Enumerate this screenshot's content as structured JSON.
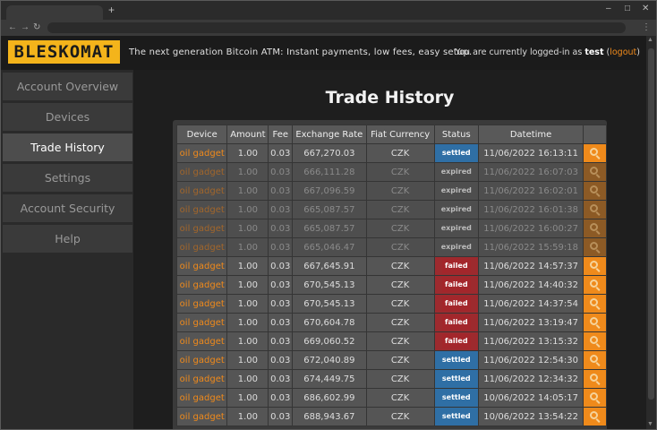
{
  "header": {
    "logo": "BLESKOMAT",
    "tagline": "The next generation Bitcoin ATM: Instant payments, low fees, easy setup.",
    "login_prefix": "You are currently logged-in as",
    "username": "test",
    "logout_label": "logout"
  },
  "sidebar": {
    "items": [
      {
        "label": "Account Overview"
      },
      {
        "label": "Devices"
      },
      {
        "label": "Trade History"
      },
      {
        "label": "Settings"
      },
      {
        "label": "Account Security"
      },
      {
        "label": "Help"
      }
    ]
  },
  "main": {
    "title": "Trade History",
    "columns": [
      "Device",
      "Amount",
      "Fee",
      "Exchange Rate",
      "Fiat Currency",
      "Status",
      "Datetime"
    ],
    "rows": [
      {
        "device": "oil gadget",
        "amount": "1.00",
        "fee": "0.03",
        "rate": "667,270.03",
        "fiat": "CZK",
        "status": "settled",
        "datetime": "11/06/2022 16:13:11"
      },
      {
        "device": "oil gadget",
        "amount": "1.00",
        "fee": "0.03",
        "rate": "666,111.28",
        "fiat": "CZK",
        "status": "expired",
        "datetime": "11/06/2022 16:07:03"
      },
      {
        "device": "oil gadget",
        "amount": "1.00",
        "fee": "0.03",
        "rate": "667,096.59",
        "fiat": "CZK",
        "status": "expired",
        "datetime": "11/06/2022 16:02:01"
      },
      {
        "device": "oil gadget",
        "amount": "1.00",
        "fee": "0.03",
        "rate": "665,087.57",
        "fiat": "CZK",
        "status": "expired",
        "datetime": "11/06/2022 16:01:38"
      },
      {
        "device": "oil gadget",
        "amount": "1.00",
        "fee": "0.03",
        "rate": "665,087.57",
        "fiat": "CZK",
        "status": "expired",
        "datetime": "11/06/2022 16:00:27"
      },
      {
        "device": "oil gadget",
        "amount": "1.00",
        "fee": "0.03",
        "rate": "665,046.47",
        "fiat": "CZK",
        "status": "expired",
        "datetime": "11/06/2022 15:59:18"
      },
      {
        "device": "oil gadget",
        "amount": "1.00",
        "fee": "0.03",
        "rate": "667,645.91",
        "fiat": "CZK",
        "status": "failed",
        "datetime": "11/06/2022 14:57:37"
      },
      {
        "device": "oil gadget",
        "amount": "1.00",
        "fee": "0.03",
        "rate": "670,545.13",
        "fiat": "CZK",
        "status": "failed",
        "datetime": "11/06/2022 14:40:32"
      },
      {
        "device": "oil gadget",
        "amount": "1.00",
        "fee": "0.03",
        "rate": "670,545.13",
        "fiat": "CZK",
        "status": "failed",
        "datetime": "11/06/2022 14:37:54"
      },
      {
        "device": "oil gadget",
        "amount": "1.00",
        "fee": "0.03",
        "rate": "670,604.78",
        "fiat": "CZK",
        "status": "failed",
        "datetime": "11/06/2022 13:19:47"
      },
      {
        "device": "oil gadget",
        "amount": "1.00",
        "fee": "0.03",
        "rate": "669,060.52",
        "fiat": "CZK",
        "status": "failed",
        "datetime": "11/06/2022 13:15:32"
      },
      {
        "device": "oil gadget",
        "amount": "1.00",
        "fee": "0.03",
        "rate": "672,040.89",
        "fiat": "CZK",
        "status": "settled",
        "datetime": "11/06/2022 12:54:30"
      },
      {
        "device": "oil gadget",
        "amount": "1.00",
        "fee": "0.03",
        "rate": "674,449.75",
        "fiat": "CZK",
        "status": "settled",
        "datetime": "11/06/2022 12:34:32"
      },
      {
        "device": "oil gadget",
        "amount": "1.00",
        "fee": "0.03",
        "rate": "686,602.99",
        "fiat": "CZK",
        "status": "settled",
        "datetime": "10/06/2022 14:05:17"
      },
      {
        "device": "oil gadget",
        "amount": "1.00",
        "fee": "0.03",
        "rate": "688,943.67",
        "fiat": "CZK",
        "status": "settled",
        "datetime": "10/06/2022 13:54:22"
      }
    ]
  },
  "colors": {
    "accent": "#ef8a1b",
    "settled": "#2f6fa5",
    "failed": "#9d2a2e",
    "logo": "#f4b41b"
  }
}
